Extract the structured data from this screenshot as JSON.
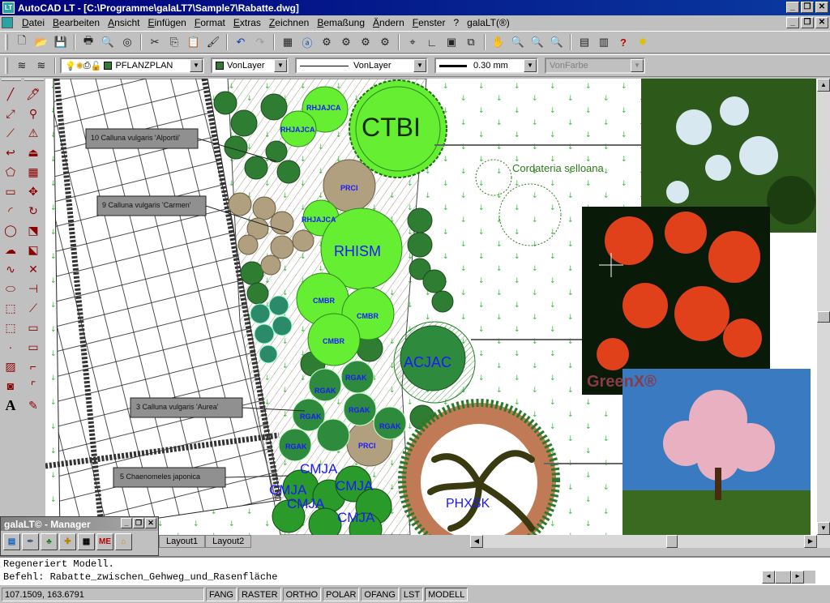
{
  "window": {
    "title": "AutoCAD LT - [C:\\Programme\\galaLT7\\Sample7\\Rabatte.dwg]",
    "buttons": [
      "_",
      "❐",
      "✕"
    ]
  },
  "menu": {
    "items": [
      "Datei",
      "Bearbeiten",
      "Ansicht",
      "Einfügen",
      "Format",
      "Extras",
      "Zeichnen",
      "Bemaßung",
      "Ändern",
      "Fenster",
      "?",
      "galaLT(®)"
    ]
  },
  "layer_toolbar": {
    "layer": "PFLANZPLAN",
    "color": "VonLayer",
    "linetype": "VonLayer",
    "lineweight": "0.30 mm",
    "plotstyle": "VonFarbe"
  },
  "drawing": {
    "labels": {
      "plant_10": "10  Calluna vulgaris 'Alportii'",
      "plant_9": "9  Calluna vulgaris 'Carmen'",
      "plant_3": "3  Calluna vulgaris 'Aurea'",
      "plant_5": "5  Chaenomeles japonica",
      "cordateria": "Cordateria selloana",
      "ctbi": "CTBI",
      "rhism": "RHISM",
      "acjac": "ACJAC",
      "phxsk": "PHXSK",
      "rhjajca_1": "RHJAJCA",
      "rhjajca_2": "RHJAJCA",
      "rhjajca_3": "RHJAJCA",
      "prci_1": "PRCI",
      "prci_2": "PRCI",
      "cmbr_1": "CMBR",
      "cmbr_2": "CMBR",
      "cmbr_3": "CMBR",
      "rgak_1": "RGAK",
      "rgak_2": "RGAK",
      "rgak_3": "RGAK",
      "rgak_4": "RGAK",
      "rgak_5": "RGAK",
      "rgak_6": "RGAK",
      "cmja_1": "CMJA",
      "cmja_2": "CMJA",
      "cmja_3": "CMJA",
      "cmja_4": "CMJA",
      "cmja_5": "CMJA"
    },
    "photo_watermark": "GreenX®"
  },
  "layout_tabs": [
    "Layout1",
    "Layout2"
  ],
  "command_line": {
    "history": "Regeneriert Modell.",
    "prompt": "Befehl: Rabatte_zwischen_Gehweg_und_Rasenfläche"
  },
  "status": {
    "coordinates": "107.1509, 163.6791",
    "toggles": [
      "FANG",
      "RASTER",
      "ORTHO",
      "POLAR",
      "OFANG",
      "LST",
      "MODELL"
    ],
    "active": "MODELL"
  },
  "manager": {
    "title": "galaLT© - Manager",
    "tools": [
      "layer-icon",
      "pen-icon",
      "tree-icon",
      "measure-icon",
      "grid-icon",
      "ME",
      "house-icon"
    ]
  },
  "colors": {
    "title_bar": "#00007b",
    "plant_dark": "#2e7d32",
    "plant_light": "#66ff33",
    "plant_tan": "#b0a080",
    "label_blue": "#1a1aff"
  }
}
